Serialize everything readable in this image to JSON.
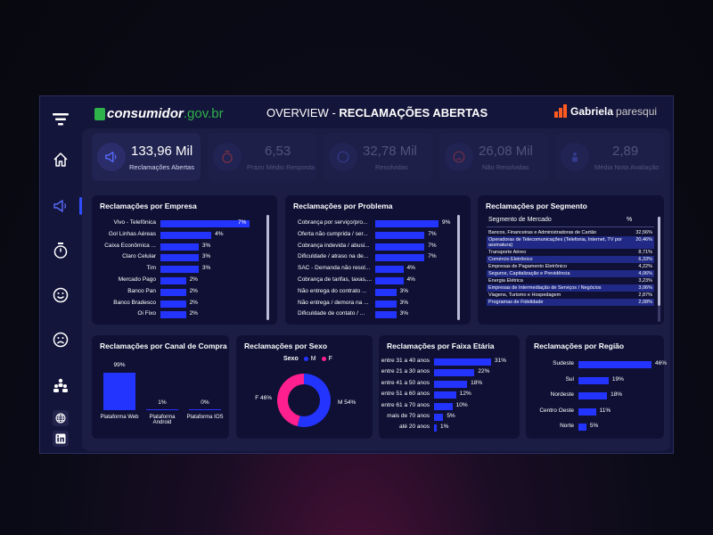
{
  "header": {
    "logo_main": "consumidor",
    "logo_gov": ".gov.br",
    "title_prefix": "OVERVIEW - ",
    "title_main": "RECLAMAÇÕES ABERTAS",
    "brand_first": "Gabriela",
    "brand_last": "paresqui"
  },
  "sidebar": {
    "items": [
      {
        "name": "menu-icon"
      },
      {
        "name": "home-icon"
      },
      {
        "name": "megaphone-icon",
        "active": true
      },
      {
        "name": "stopwatch-icon"
      },
      {
        "name": "smile-icon"
      },
      {
        "name": "frown-icon"
      },
      {
        "name": "people-icon"
      },
      {
        "name": "globe-icon"
      },
      {
        "name": "linkedin-icon"
      }
    ],
    "active_color": "#2f4dff"
  },
  "kpis": [
    {
      "value": "133,96 Mil",
      "label": "Reclamações Abertas",
      "icon": "megaphone-icon",
      "active": true
    },
    {
      "value": "6,53",
      "label": "Prazo Médio Resposta",
      "icon": "stopwatch-icon",
      "active": false
    },
    {
      "value": "32,78 Mil",
      "label": "Resolvidas",
      "icon": "smile-icon",
      "active": false
    },
    {
      "value": "26,08 Mil",
      "label": "Não Resolvidas",
      "icon": "frown-icon",
      "active": false
    },
    {
      "value": "2,89",
      "label": "Média Nota Avaliação",
      "icon": "people-icon",
      "active": false
    }
  ],
  "empresa": {
    "title": "Reclamações por Empresa",
    "rows": [
      {
        "label": "Vivo - Telefônica",
        "value": "7%",
        "pct": 7,
        "highlight": true
      },
      {
        "label": "Gol Linhas Aéreas",
        "value": "4%",
        "pct": 4
      },
      {
        "label": "Caixa Econômica ...",
        "value": "3%",
        "pct": 3
      },
      {
        "label": "Claro Celular",
        "value": "3%",
        "pct": 3
      },
      {
        "label": "Tim",
        "value": "3%",
        "pct": 3
      },
      {
        "label": "Mercado Pago",
        "value": "2%",
        "pct": 2
      },
      {
        "label": "Banco Pan",
        "value": "2%",
        "pct": 2
      },
      {
        "label": "Banco Bradesco",
        "value": "2%",
        "pct": 2
      },
      {
        "label": "Oi Fixo",
        "value": "2%",
        "pct": 2
      }
    ]
  },
  "problema": {
    "title": "Reclamações por Problema",
    "rows": [
      {
        "label": "Cobrança por serviço/pro...",
        "value": "9%",
        "pct": 9
      },
      {
        "label": "Oferta não cumprida / ser...",
        "value": "7%",
        "pct": 7
      },
      {
        "label": "Cobrança indevida / abusi...",
        "value": "7%",
        "pct": 7
      },
      {
        "label": "Dificuldade / atraso na de...",
        "value": "7%",
        "pct": 7
      },
      {
        "label": "SAC - Demanda não resol...",
        "value": "4%",
        "pct": 4
      },
      {
        "label": "Cobrança de tarifas, taxas,...",
        "value": "4%",
        "pct": 4
      },
      {
        "label": "Não entrega do contrato ...",
        "value": "3%",
        "pct": 3
      },
      {
        "label": "Não entrega / demora na ...",
        "value": "3%",
        "pct": 3
      },
      {
        "label": "Dificuldade de contato / ...",
        "value": "3%",
        "pct": 3
      }
    ]
  },
  "segmento": {
    "title": "Reclamações por Segmento",
    "col_name": "Segmento de Mercado",
    "col_pct": "%",
    "rows": [
      {
        "label": "Bancos, Financeiras e Administradoras de Cartão",
        "value": "32,56%"
      },
      {
        "label": "Operadoras de Telecomunicações (Telefonia, Internet, TV por assinatura)",
        "value": "20,46%"
      },
      {
        "label": "Transporte Aéreo",
        "value": "8,71%"
      },
      {
        "label": "Comércio Eletrônico",
        "value": "6,33%"
      },
      {
        "label": "Empresas de Pagamento Eletrônico",
        "value": "4,22%"
      },
      {
        "label": "Seguros, Capitalização e Previdência",
        "value": "4,06%"
      },
      {
        "label": "Energia Elétrica",
        "value": "3,23%"
      },
      {
        "label": "Empresas de Intermediação de Serviços / Negócios",
        "value": "3,06%"
      },
      {
        "label": "Viagens, Turismo e Hospedagem",
        "value": "2,87%"
      },
      {
        "label": "Programas de Fidelidade",
        "value": "2,08%"
      }
    ]
  },
  "canal": {
    "title": "Reclamações por Canal de Compra",
    "rows": [
      {
        "label": "Plataforma Web",
        "value": "99%",
        "pct": 99
      },
      {
        "label": "Plataforma Android",
        "value": "1%",
        "pct": 1
      },
      {
        "label": "Plataforma IOS",
        "value": "0%",
        "pct": 0
      }
    ]
  },
  "sexo": {
    "title": "Reclamações por Sexo",
    "legend_title": "Sexo",
    "slices": [
      {
        "name": "M",
        "pct": 54,
        "label": "M 54%",
        "color": "#2434ff"
      },
      {
        "name": "F",
        "pct": 46,
        "label": "F 46%",
        "color": "#ff1f8e"
      }
    ]
  },
  "faixa": {
    "title": "Reclamações por Faixa Etária",
    "rows": [
      {
        "label": "entre 31 a 40 anos",
        "value": "31%",
        "pct": 31
      },
      {
        "label": "entre 21 a 30 anos",
        "value": "22%",
        "pct": 22
      },
      {
        "label": "entre 41 a 50 anos",
        "value": "18%",
        "pct": 18
      },
      {
        "label": "entre 51 a 60 anos",
        "value": "12%",
        "pct": 12
      },
      {
        "label": "entre 61 a 70 anos",
        "value": "10%",
        "pct": 10
      },
      {
        "label": "mais de 70 anos",
        "value": "5%",
        "pct": 5
      },
      {
        "label": "até 20 anos",
        "value": "1%",
        "pct": 1
      }
    ]
  },
  "regiao": {
    "title": "Reclamações por Região",
    "rows": [
      {
        "label": "Sudeste",
        "value": "46%",
        "pct": 46
      },
      {
        "label": "Sul",
        "value": "19%",
        "pct": 19
      },
      {
        "label": "Nordeste",
        "value": "18%",
        "pct": 18
      },
      {
        "label": "Centro Oeste",
        "value": "11%",
        "pct": 11
      },
      {
        "label": "Norte",
        "value": "5%",
        "pct": 5
      }
    ]
  },
  "colors": {
    "bar": "#2434ff",
    "male": "#2434ff",
    "female": "#ff1f8e",
    "highlight": "#2f4dff"
  }
}
